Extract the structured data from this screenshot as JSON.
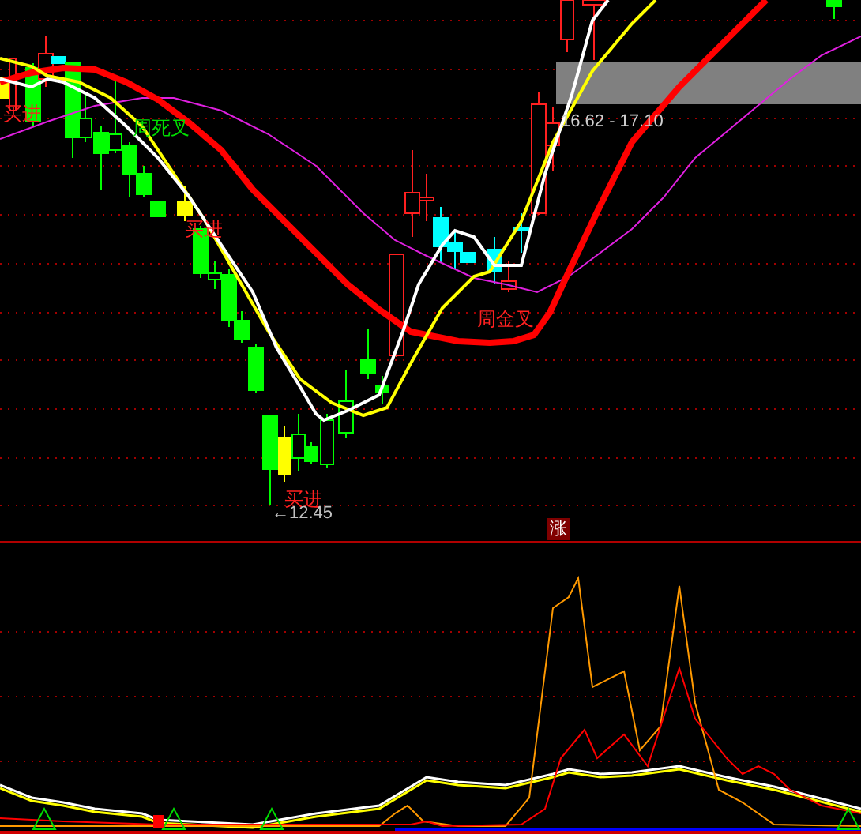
{
  "main_chart": {
    "signals": [
      {
        "text": "买进"
      },
      {
        "text": "买进"
      },
      {
        "text": "买进"
      }
    ],
    "cross_labels": [
      {
        "kind": "death",
        "text": "周死叉"
      },
      {
        "kind": "golden",
        "text": "周金叉"
      }
    ],
    "range_label": "16.62 - 17.10",
    "low_marker": {
      "arrow": "←",
      "value": "12.45"
    }
  },
  "indicator_panel": {
    "badge": "涨"
  }
}
